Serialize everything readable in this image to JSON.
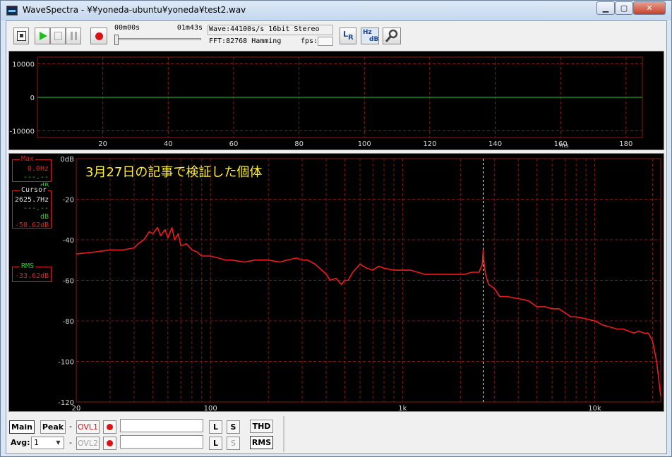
{
  "window": {
    "title": "WaveSpectra - ¥¥yoneda-ubuntu¥yoneda¥test2.wav",
    "min_glyph": "▁",
    "max_glyph": "▢",
    "close_glyph": "✕"
  },
  "toolbar": {
    "seek_start": "00m00s",
    "seek_end": "01m43s",
    "seek_fraction": 0.0,
    "wave_info": "Wave:44100s/s 16bit Stereo",
    "fft_info": "FFT:82768 Hamming",
    "fps_label": "fps:",
    "lr_label_l": "L",
    "lr_label_r": "R",
    "hzdb_label_hz": "Hz",
    "hzdb_label_db": "dB",
    "icons": [
      "open-icon",
      "play-icon",
      "stop-icon",
      "pause-icon",
      "record-icon",
      "lr-icon",
      "hz-db-icon",
      "settings-icon"
    ]
  },
  "readouts": {
    "max": {
      "title": "Max",
      "line1": "0.0Hz",
      "line2": "---.--dB"
    },
    "cursor": {
      "title": "Cursor",
      "line1": "2625.7Hz",
      "line2": "---.--dB",
      "line3": "-50.62dB"
    },
    "rms": {
      "title": "RMS",
      "line1": "-33.62dB"
    }
  },
  "bottom": {
    "main_label": "Main",
    "peak_label": "Peak",
    "dash": "-",
    "ovl1_label": "OVL1",
    "ovl2_label": "OVL2",
    "l_label": "L",
    "s_label": "S",
    "avg_label": "Avg:",
    "avg_value": "1",
    "thd_label": "THD",
    "rms_label": "RMS"
  },
  "chart_data": [
    {
      "type": "line",
      "title": "",
      "xlabel": "ms",
      "ylabel": "",
      "xlim": [
        0,
        185
      ],
      "ylim": [
        -12000,
        12000
      ],
      "yticks": [
        10000,
        0,
        -10000
      ],
      "ytick_labels": [
        "10000",
        "0",
        "-10000"
      ],
      "xticks": [
        20,
        40,
        60,
        80,
        100,
        120,
        140,
        160,
        180
      ],
      "xtick_labels": [
        "20",
        "40",
        "60",
        "80",
        "100",
        "120",
        "140",
        "160",
        "180"
      ],
      "grid": true,
      "series": [
        {
          "x": [
            0,
            185
          ],
          "y": [
            0,
            0
          ],
          "color": "#22cc22"
        }
      ]
    },
    {
      "type": "line",
      "annotation": "3月27日の記事で検証した個体",
      "xlabel": "",
      "ylabel": "",
      "xscale": "log",
      "xlim": [
        20,
        22050
      ],
      "ylim": [
        -120,
        0
      ],
      "yticks": [
        0,
        -20,
        -40,
        -60,
        -80,
        -100,
        -120
      ],
      "ytick_labels": [
        "0dB",
        "-20",
        "-40",
        "-60",
        "-80",
        "-100",
        "-120"
      ],
      "xticks": [
        20,
        100,
        1000,
        10000
      ],
      "xtick_labels": [
        "20",
        "100",
        "1k",
        "10k"
      ],
      "grid": true,
      "cursor_x": 2625.7,
      "series": [
        {
          "color": "#ee1c1c",
          "x": [
            20,
            25,
            30,
            35,
            40,
            42,
            45,
            48,
            50,
            53,
            55,
            58,
            60,
            63,
            65,
            68,
            70,
            75,
            80,
            85,
            90,
            100,
            110,
            120,
            130,
            150,
            170,
            200,
            230,
            250,
            280,
            300,
            320,
            350,
            380,
            400,
            420,
            450,
            480,
            500,
            520,
            550,
            600,
            650,
            700,
            750,
            800,
            900,
            1000,
            1100,
            1200,
            1300,
            1400,
            1500,
            1700,
            1900,
            2100,
            2300,
            2500,
            2600,
            2625,
            2650,
            2700,
            2800,
            3000,
            3200,
            3500,
            4000,
            4500,
            5000,
            5500,
            6000,
            6500,
            7000,
            7500,
            8000,
            9000,
            10000,
            11000,
            12000,
            13000,
            14000,
            15000,
            16000,
            17000,
            18000,
            19000,
            20000,
            21000,
            22050
          ],
          "y": [
            -47,
            -46,
            -45,
            -45,
            -44,
            -42,
            -40,
            -36,
            -37,
            -34,
            -38,
            -35,
            -39,
            -34,
            -40,
            -37,
            -43,
            -42,
            -45,
            -46,
            -48,
            -48,
            -49,
            -50,
            -50,
            -51,
            -50,
            -50,
            -51,
            -50,
            -49,
            -50,
            -50,
            -52,
            -55,
            -57,
            -60,
            -59,
            -62,
            -60,
            -60,
            -56,
            -52,
            -54,
            -55,
            -53,
            -54,
            -55,
            -55,
            -55,
            -56,
            -57,
            -57,
            -57,
            -57,
            -57,
            -57,
            -56,
            -56,
            -52,
            -45,
            -51,
            -57,
            -62,
            -64,
            -68,
            -68,
            -69,
            -70,
            -73,
            -73,
            -74,
            -74,
            -76,
            -78,
            -78,
            -79,
            -80,
            -82,
            -83,
            -84,
            -84,
            -85,
            -86,
            -85,
            -86,
            -86,
            -90,
            -100,
            -117
          ]
        }
      ]
    }
  ]
}
